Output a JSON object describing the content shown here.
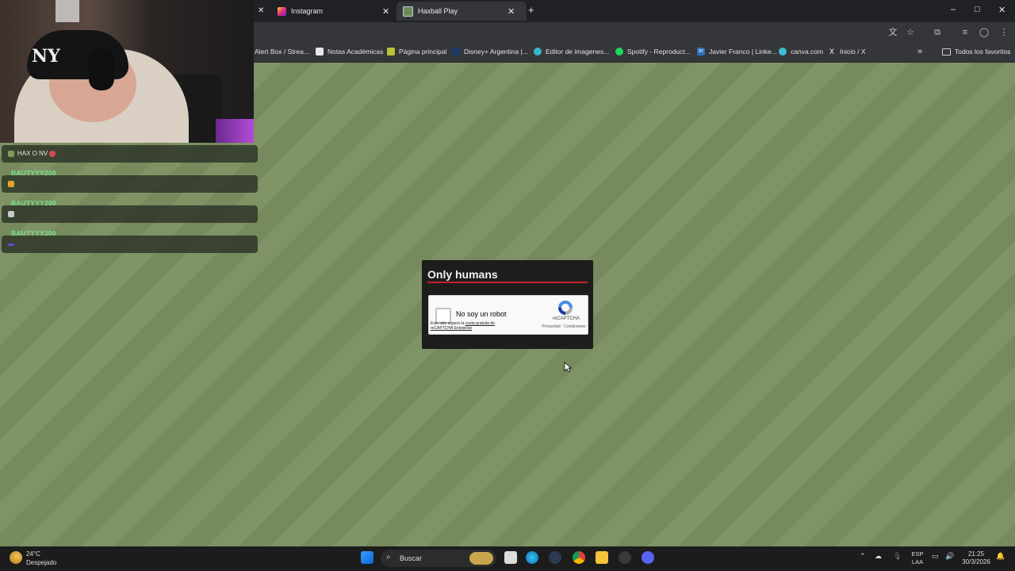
{
  "browser": {
    "tabs": [
      {
        "title": "Instagram",
        "active": false
      },
      {
        "title": "Haxball Play",
        "active": true
      }
    ],
    "new_tab": "+",
    "window_controls": {
      "minimize": "–",
      "maximize": "□",
      "close": "✕"
    }
  },
  "bookmarks": {
    "items": [
      {
        "label": "Alert Box / Strea..."
      },
      {
        "label": "Notas Académicas"
      },
      {
        "label": "Página principal"
      },
      {
        "label": "Disney+ Argentina |..."
      },
      {
        "label": "Editor de imagenes..."
      },
      {
        "label": "Spotify - Reproduct..."
      },
      {
        "label": "Javier Franco | Linke..."
      },
      {
        "label": "canva.com"
      },
      {
        "label": "Inicio / X"
      }
    ],
    "more": "»",
    "all_favorites": "Todos los favoritos"
  },
  "chat": {
    "items": [
      {
        "user": "BAUTYYY200",
        "message": "HAX O NV"
      },
      {
        "user": "BAUTYYY200",
        "message": ""
      },
      {
        "user": "BAUTYYY200",
        "message": ""
      },
      {
        "user": "BAUTYYY200",
        "message": ""
      }
    ]
  },
  "captcha": {
    "title": "Only humans",
    "checkbox_label": "No soy un robot",
    "note_prefix": "Este sitio supera la ",
    "note_link": "cuota gratuita de reCAPTCHA Enterprise",
    "brand": "reCAPTCHA",
    "links": "Privacidad - Condiciones"
  },
  "taskbar": {
    "weather_temp": "24°C",
    "weather_desc": "Despejado",
    "search_label": "Buscar",
    "lang_top": "ESP",
    "lang_bottom": "LAA",
    "time": "21:25",
    "date": "30/3/2026"
  },
  "colors": {
    "page_background": "#7c9063",
    "captcha_accent": "#c3222c",
    "chat_username": "#7be38a"
  }
}
